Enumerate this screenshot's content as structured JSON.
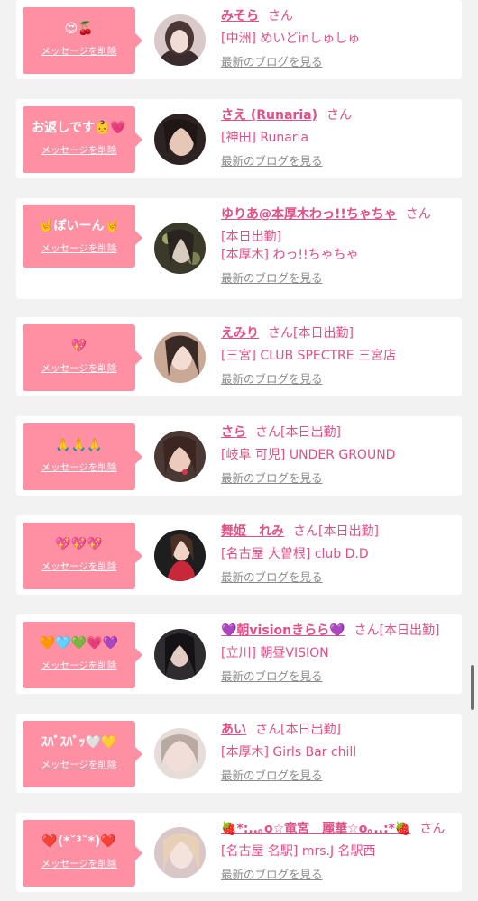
{
  "delete_label": "メッセージを削除",
  "blog_label": "最新のブログを見る",
  "san_label": "さん",
  "accent_color": "#e44d86",
  "bubble_color": "#ff8fa3",
  "items": [
    {
      "message": "😍🍒",
      "name": "みそら",
      "extra": "",
      "shop": "[中洲] めいどinしゅしゅ",
      "shop2": ""
    },
    {
      "message": "お返しです👶💗",
      "name": "さえ (Runaria)",
      "extra": "",
      "shop": "[神田] Runaria",
      "shop2": ""
    },
    {
      "message": "🤘ぼいーん🤘",
      "name": "ゆりあ@本厚木わっ!!ちゃちゃ",
      "extra": "",
      "shop": "[本日出勤]",
      "shop2": "[本厚木] わっ!!ちゃちゃ"
    },
    {
      "message": "💖",
      "name": "えみり",
      "extra": "[本日出勤]",
      "shop": "[三宮] CLUB SPECTRE 三宮店",
      "shop2": ""
    },
    {
      "message": "🙏🙏🙏",
      "name": "さら",
      "extra": "[本日出勤]",
      "shop": "[岐阜 可児] UNDER GROUND",
      "shop2": ""
    },
    {
      "message": "💖💖💖",
      "name": "舞姫　れみ",
      "extra": "[本日出勤]",
      "shop": "[名古屋 大曽根] club D.D",
      "shop2": ""
    },
    {
      "message": "🧡🩵💚💗💜",
      "name": "💜朝visionきらら💜",
      "extra": "[本日出勤]",
      "shop": "[立川] 朝昼VISION",
      "shop2": ""
    },
    {
      "message": "ｽﾊﾞｽﾊﾞｯ🤍💛",
      "name": "あい",
      "extra": "[本日出勤]",
      "shop": "[本厚木] Girls Bar chill",
      "shop2": ""
    },
    {
      "message": "❤️(*˘³˘*)❤️",
      "name": "🍓*:..｡o☆竜宮　麗華☆o｡..:*🍓",
      "extra": "",
      "shop": "[名古屋 名駅] mrs.J 名駅西",
      "shop2": ""
    }
  ]
}
